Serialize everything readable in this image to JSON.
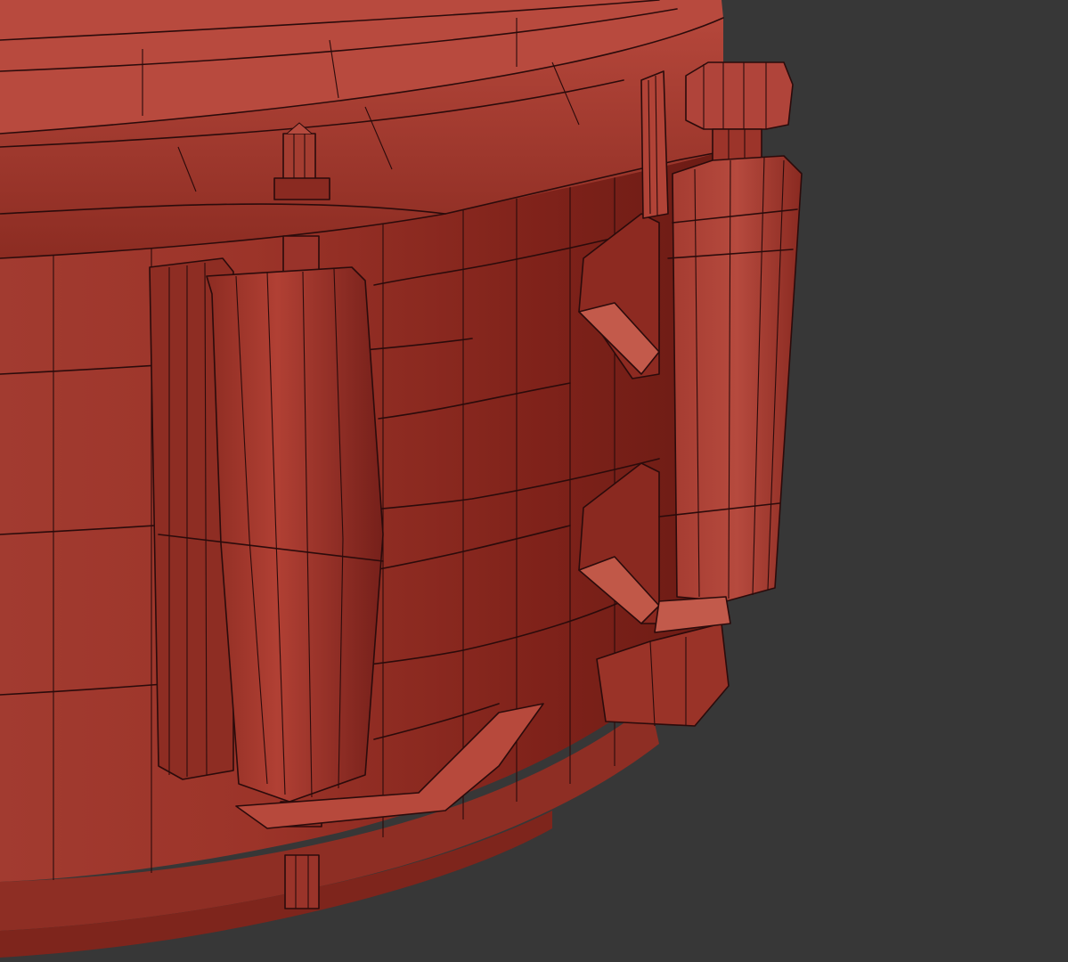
{
  "scene": {
    "background_color": "#373737",
    "mesh_color": "#a13a2f",
    "wire_color": "#2b0b0b",
    "subject": "snare-drum-wireframe"
  }
}
